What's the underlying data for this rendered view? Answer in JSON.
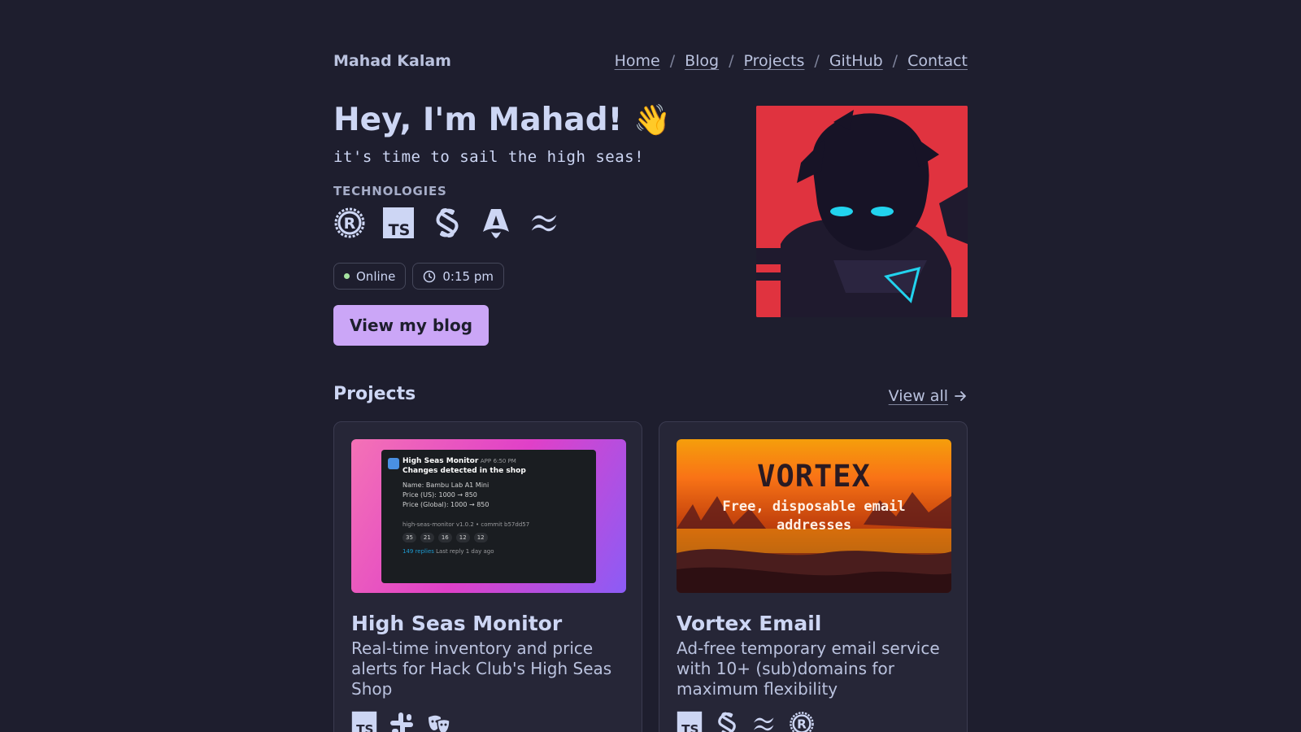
{
  "header": {
    "brand": "Mahad Kalam",
    "nav": [
      "Home",
      "Blog",
      "Projects",
      "GitHub",
      "Contact"
    ],
    "separator": "/"
  },
  "hero": {
    "title": "Hey, I'm Mahad!",
    "wave": "👋",
    "tagline": "it's time to sail the high seas!",
    "technologies_label": "TECHNOLOGIES",
    "technologies": [
      "rust-icon",
      "typescript-icon",
      "svelte-icon",
      "astro-icon",
      "tailwind-icon"
    ],
    "status": "Online",
    "time": "0:15 pm",
    "cta": "View my blog"
  },
  "projects": {
    "title": "Projects",
    "view_all": "View all",
    "items": [
      {
        "title": "High Seas Monitor",
        "description": "Real-time inventory and price alerts for Hack Club's High Seas Shop",
        "tech": [
          "typescript-icon",
          "slack-icon",
          "theater-masks-icon"
        ],
        "thumb": {
          "app": "High Seas Monitor",
          "badge": "APP",
          "time": "6:50 PM",
          "heading": "Changes detected in the shop",
          "line1": "Name: Bambu Lab A1 Mini",
          "line2": "Price (US): 1000 → 850",
          "line3": "Price (Global): 1000 → 850",
          "footer": "high-seas-monitor v1.0.2 • commit b57dd57",
          "reactions": [
            "35",
            "21",
            "16",
            "12",
            "12"
          ],
          "replies": "149 replies",
          "last_reply": "Last reply 1 day ago"
        }
      },
      {
        "title": "Vortex Email",
        "description": "Ad-free temporary email service with 10+ (sub)domains for maximum flexibility",
        "tech": [
          "typescript-icon",
          "svelte-icon",
          "tailwind-icon",
          "rust-icon"
        ],
        "thumb": {
          "title": "VORTEX",
          "subtitle": "Free, disposable email addresses"
        }
      }
    ]
  },
  "colors": {
    "background": "#1e1e2e",
    "accent": "#cba6f7",
    "online": "#a6e3a1",
    "avatar_bg": "#e0333f"
  }
}
